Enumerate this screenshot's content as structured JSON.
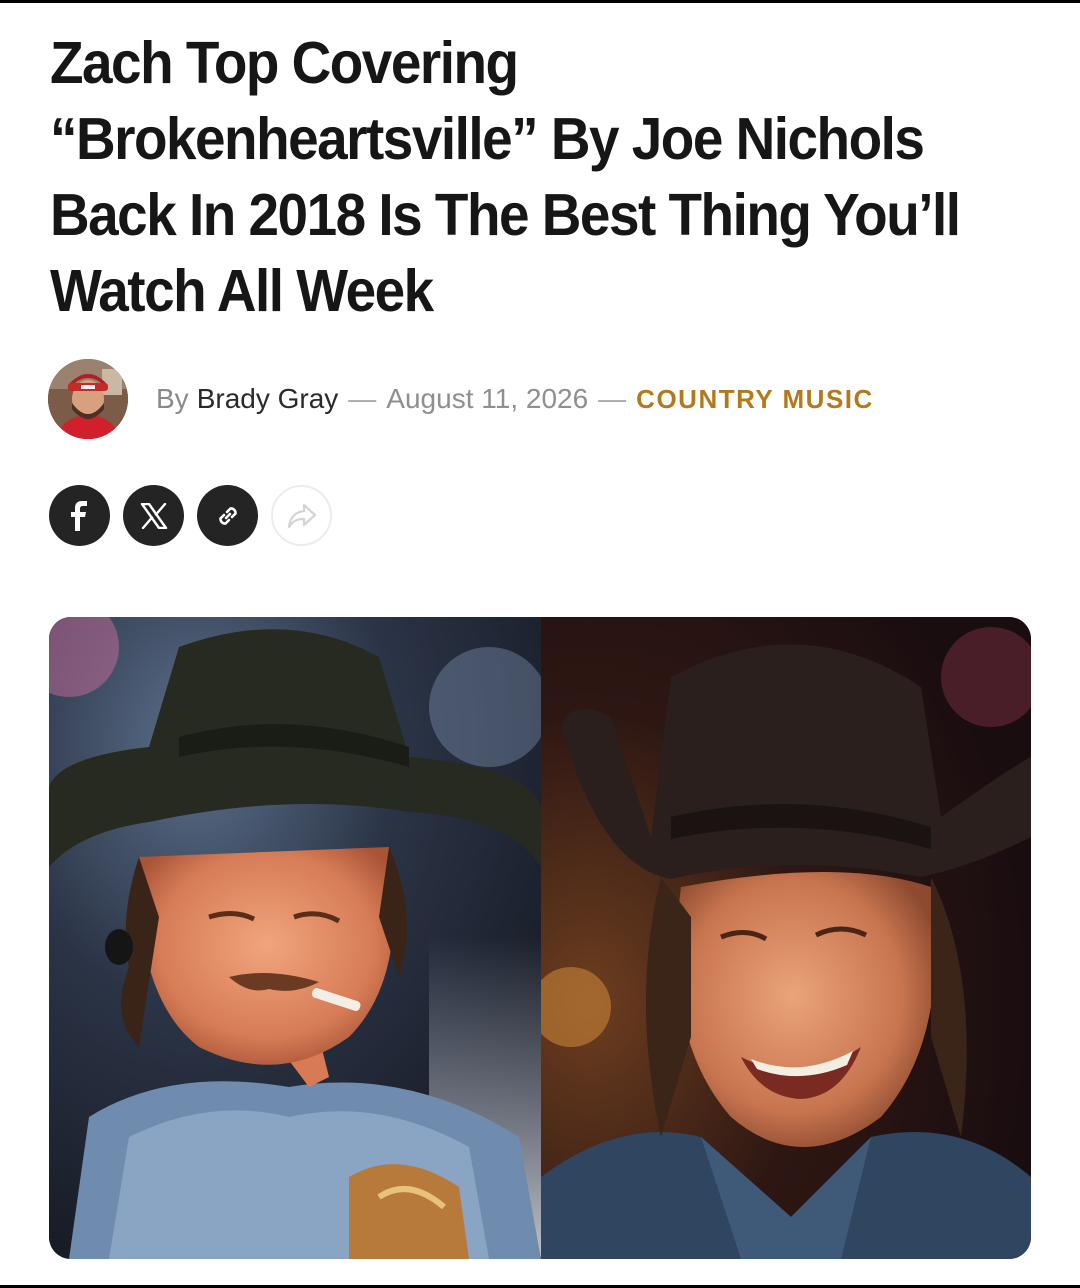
{
  "article": {
    "headline": "Zach Top Covering “Brokenheartsville” By Joe Nichols Back In 2018 Is The Best Thing You’ll Watch All Week"
  },
  "byline": {
    "prefix": "By",
    "author": "Brady Gray",
    "separator": "—",
    "date": "August 11, 2026",
    "category": "COUNTRY MUSIC"
  },
  "share": {
    "buttons": [
      {
        "icon": "facebook-icon"
      },
      {
        "icon": "x-icon"
      },
      {
        "icon": "link-icon"
      },
      {
        "icon": "share-arrow-icon"
      }
    ]
  },
  "colors": {
    "category": "#b27a1c",
    "share_button": "#242424",
    "headline": "#161616"
  }
}
